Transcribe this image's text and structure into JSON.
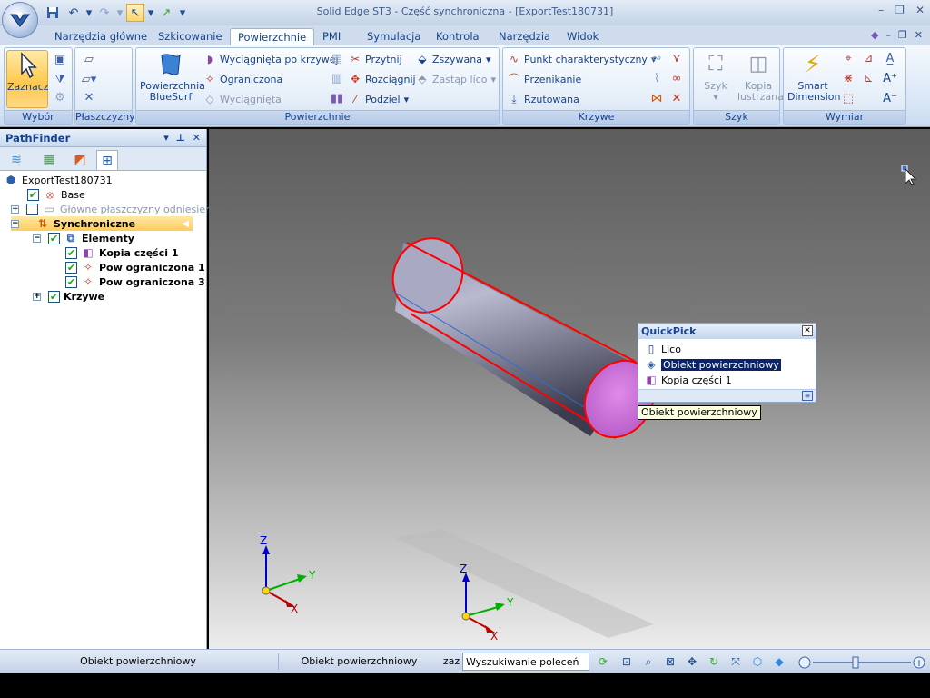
{
  "window": {
    "title": "Solid Edge ST3 - Część synchroniczna - [ExportTest180731]",
    "minimize_glyph": "–",
    "restore_glyph": "❐",
    "close_glyph": "✕"
  },
  "quick_access": [
    {
      "name": "save-icon",
      "glyph": "💾"
    },
    {
      "name": "undo-icon",
      "glyph": "↶"
    },
    {
      "name": "undo-dropdown-icon",
      "glyph": "▾"
    },
    {
      "name": "redo-icon",
      "glyph": "↷"
    },
    {
      "name": "redo-dropdown-icon",
      "glyph": "▾"
    },
    {
      "name": "select-tool-icon",
      "glyph": "↖"
    },
    {
      "name": "select-dropdown-icon",
      "glyph": "▾"
    },
    {
      "name": "open-icon",
      "glyph": "↗"
    },
    {
      "name": "customize-qat-icon",
      "glyph": "▾"
    }
  ],
  "tabs": [
    {
      "label": "Narzędzia główne",
      "active": false
    },
    {
      "label": "Szkicowanie",
      "active": false
    },
    {
      "label": "Powierzchnie",
      "active": true
    },
    {
      "label": "PMI",
      "active": false
    },
    {
      "label": "Symulacja",
      "active": false
    },
    {
      "label": "Kontrola",
      "active": false
    },
    {
      "label": "Narzędzia",
      "active": false
    },
    {
      "label": "Widok",
      "active": false
    }
  ],
  "ribbon": {
    "groups": {
      "wybor": "Wybór",
      "plaszczyzny": "Płaszczyzny",
      "powierzchnie": "Powierzchnie",
      "krzywe": "Krzywe",
      "szyk": "Szyk",
      "wymiar": "Wymiar"
    },
    "zaznacz": "Zaznacz",
    "bluesurf_line1": "Powierzchnia",
    "bluesurf_line2": "BlueSurf",
    "wyciagnieta_po_krzywej": "Wyciągnięta po krzywej",
    "ograniczona": "Ograniczona",
    "wyciagnieta": "Wyciągnięta",
    "przytnij": "Przytnij",
    "rozciagnij": "Rozciągnij",
    "podziel": "Podziel",
    "zszywana": "Zszywana",
    "zastap_lico": "Zastąp lico",
    "punkt_charakterystyczny": "Punkt charakterystyczny",
    "przenikanie": "Przenikanie",
    "rzutowana": "Rzutowana",
    "szyk": "Szyk",
    "kopia_line1": "Kopia",
    "kopia_line2": "lustrzana",
    "smart_line1": "Smart",
    "smart_line2": "Dimension"
  },
  "pathfinder": {
    "title": "PathFinder",
    "tree": [
      {
        "label": "ExportTest180731",
        "indent": 0,
        "bold": false
      },
      {
        "label": "Base",
        "indent": 1,
        "bold": false
      },
      {
        "label": "Główne płaszczyzny odniesienia",
        "indent": 1,
        "bold": false
      },
      {
        "label": "Synchroniczne",
        "indent": 1,
        "bold": true
      },
      {
        "label": "Elementy",
        "indent": 2,
        "bold": true
      },
      {
        "label": "Kopia części 1",
        "indent": 3,
        "bold": true
      },
      {
        "label": "Pow ograniczona 1",
        "indent": 3,
        "bold": true
      },
      {
        "label": "Pow ograniczona 3",
        "indent": 3,
        "bold": true
      },
      {
        "label": "Krzywe",
        "indent": 2,
        "bold": true
      }
    ]
  },
  "quickpick": {
    "title": "QuickPick",
    "items": [
      {
        "label": "Lico",
        "selected": false
      },
      {
        "label": "Obiekt powierzchniowy",
        "selected": true
      },
      {
        "label": "Kopia części 1",
        "selected": false
      }
    ],
    "tooltip": "Obiekt powierzchniowy"
  },
  "axes": {
    "x": "X",
    "y": "Y",
    "z": "Z"
  },
  "statusbar": {
    "pane1": "Obiekt powierzchniowy",
    "pane2": "Obiekt powierzchniowy",
    "pane3": "zaz",
    "search_value": "Wyszukiwanie poleceń",
    "zoom_out": "−",
    "zoom_in": "+"
  },
  "colors": {
    "accent": "#15428b",
    "selection_edge": "#ff0000",
    "highlight_face": "#cc66dd",
    "cylinder_body": "#9a9ab8",
    "selected_item_bg": "#0a246a"
  }
}
